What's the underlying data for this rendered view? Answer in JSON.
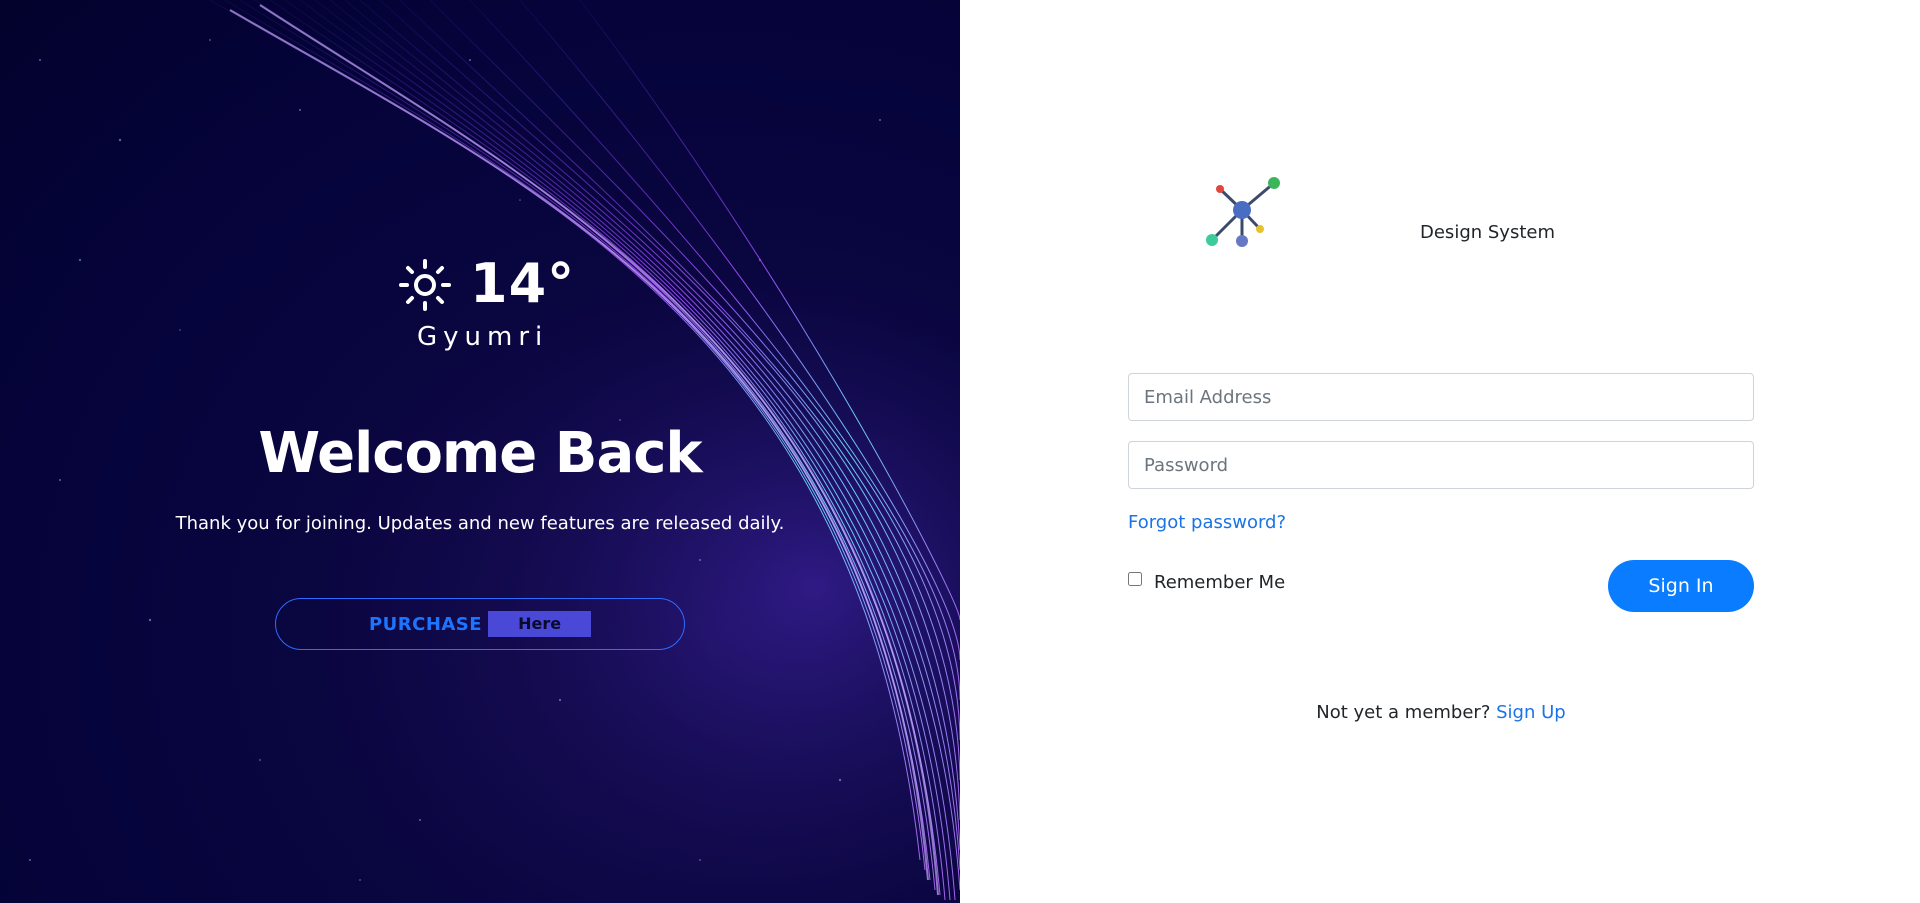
{
  "hero": {
    "weather": {
      "icon": "sun-icon",
      "temperature": "14°",
      "city": "Gyumri"
    },
    "title": "Welcome Back",
    "subtitle": "Thank you for joining. Updates and new features are released daily.",
    "purchase_button": {
      "label": "PURCHASE",
      "highlight": "Here"
    },
    "colors": {
      "background": "#05033a",
      "accent_blue": "#1d74ff",
      "highlight_bg": "#4a48d6"
    }
  },
  "login": {
    "logo_icon": "network-logo-icon",
    "brand_name": "Design System",
    "email": {
      "placeholder": "Email Address",
      "value": ""
    },
    "password": {
      "placeholder": "Password",
      "value": ""
    },
    "forgot_password": "Forgot password?",
    "remember_me": "Remember Me",
    "sign_in": "Sign In",
    "signup_prompt": "Not yet a member?",
    "signup_link": "Sign Up",
    "colors": {
      "primary": "#0a7cff",
      "link": "#1a73e8"
    }
  }
}
